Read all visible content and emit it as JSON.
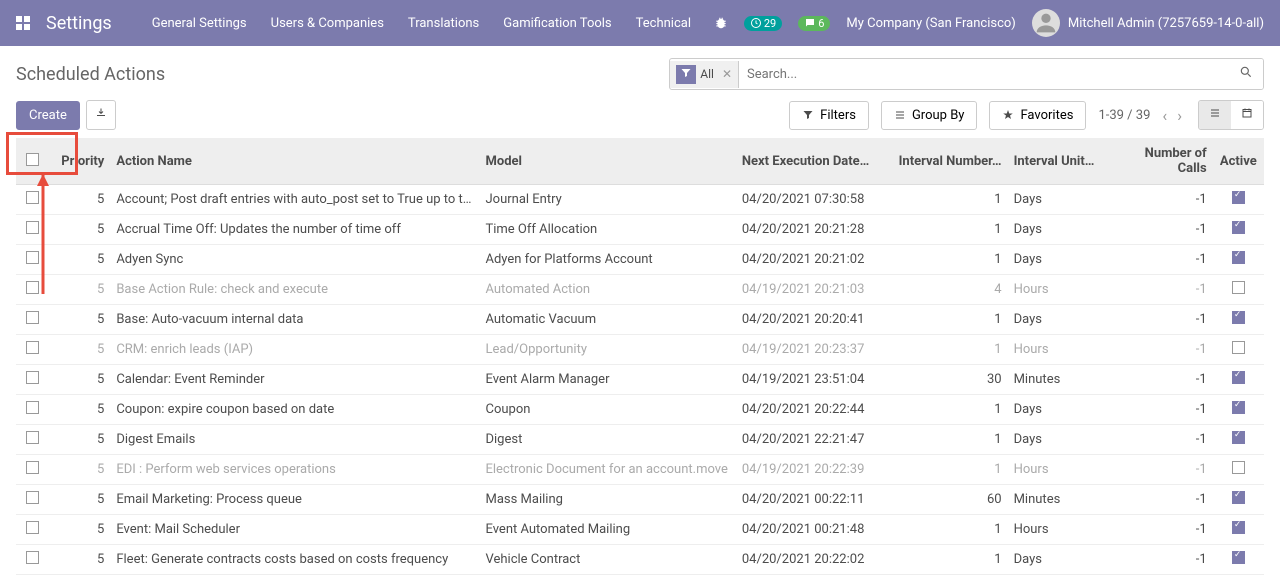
{
  "nav": {
    "brand": "Settings",
    "items": [
      "General Settings",
      "Users & Companies",
      "Translations",
      "Gamification Tools",
      "Technical"
    ],
    "clock_badge": "29",
    "chat_badge": "6",
    "company": "My Company (San Francisco)",
    "user": "Mitchell Admin (7257659-14-0-all)"
  },
  "breadcrumb": "Scheduled Actions",
  "search": {
    "filter_label": "All",
    "placeholder": "Search..."
  },
  "buttons": {
    "create": "Create",
    "filters": "Filters",
    "groupby": "Group By",
    "favorites": "Favorites"
  },
  "pager": "1-39 / 39",
  "columns": {
    "priority": "Priority",
    "name": "Action Name",
    "model": "Model",
    "date": "Next Execution Date…",
    "intnum": "Interval Number…",
    "intunit": "Interval Unit…",
    "calls": "Number of Calls",
    "active": "Active"
  },
  "rows": [
    {
      "pri": "5",
      "name": "Account; Post draft entries with auto_post set to True up to t…",
      "model": "Journal Entry",
      "date": "04/20/2021 07:30:58",
      "intnum": "1",
      "intunit": "Days",
      "calls": "-1",
      "active": true,
      "muted": false
    },
    {
      "pri": "5",
      "name": "Accrual Time Off: Updates the number of time off",
      "model": "Time Off Allocation",
      "date": "04/20/2021 20:21:28",
      "intnum": "1",
      "intunit": "Days",
      "calls": "-1",
      "active": true,
      "muted": false
    },
    {
      "pri": "5",
      "name": "Adyen Sync",
      "model": "Adyen for Platforms Account",
      "date": "04/20/2021 20:21:02",
      "intnum": "1",
      "intunit": "Days",
      "calls": "-1",
      "active": true,
      "muted": false
    },
    {
      "pri": "5",
      "name": "Base Action Rule: check and execute",
      "model": "Automated Action",
      "date": "04/19/2021 20:21:03",
      "intnum": "4",
      "intunit": "Hours",
      "calls": "-1",
      "active": false,
      "muted": true
    },
    {
      "pri": "5",
      "name": "Base: Auto-vacuum internal data",
      "model": "Automatic Vacuum",
      "date": "04/20/2021 20:20:41",
      "intnum": "1",
      "intunit": "Days",
      "calls": "-1",
      "active": true,
      "muted": false
    },
    {
      "pri": "5",
      "name": "CRM: enrich leads (IAP)",
      "model": "Lead/Opportunity",
      "date": "04/19/2021 20:23:37",
      "intnum": "1",
      "intunit": "Hours",
      "calls": "-1",
      "active": false,
      "muted": true
    },
    {
      "pri": "5",
      "name": "Calendar: Event Reminder",
      "model": "Event Alarm Manager",
      "date": "04/19/2021 23:51:04",
      "intnum": "30",
      "intunit": "Minutes",
      "calls": "-1",
      "active": true,
      "muted": false
    },
    {
      "pri": "5",
      "name": "Coupon: expire coupon based on date",
      "model": "Coupon",
      "date": "04/20/2021 20:22:44",
      "intnum": "1",
      "intunit": "Days",
      "calls": "-1",
      "active": true,
      "muted": false
    },
    {
      "pri": "5",
      "name": "Digest Emails",
      "model": "Digest",
      "date": "04/20/2021 22:21:47",
      "intnum": "1",
      "intunit": "Days",
      "calls": "-1",
      "active": true,
      "muted": false
    },
    {
      "pri": "5",
      "name": "EDI : Perform web services operations",
      "model": "Electronic Document for an account.move",
      "date": "04/19/2021 20:22:39",
      "intnum": "1",
      "intunit": "Hours",
      "calls": "-1",
      "active": false,
      "muted": true
    },
    {
      "pri": "5",
      "name": "Email Marketing: Process queue",
      "model": "Mass Mailing",
      "date": "04/20/2021 00:22:11",
      "intnum": "60",
      "intunit": "Minutes",
      "calls": "-1",
      "active": true,
      "muted": false
    },
    {
      "pri": "5",
      "name": "Event: Mail Scheduler",
      "model": "Event Automated Mailing",
      "date": "04/20/2021 00:21:48",
      "intnum": "1",
      "intunit": "Hours",
      "calls": "-1",
      "active": true,
      "muted": false
    },
    {
      "pri": "5",
      "name": "Fleet: Generate contracts costs based on costs frequency",
      "model": "Vehicle Contract",
      "date": "04/20/2021 20:22:02",
      "intnum": "1",
      "intunit": "Days",
      "calls": "-1",
      "active": true,
      "muted": false
    }
  ]
}
